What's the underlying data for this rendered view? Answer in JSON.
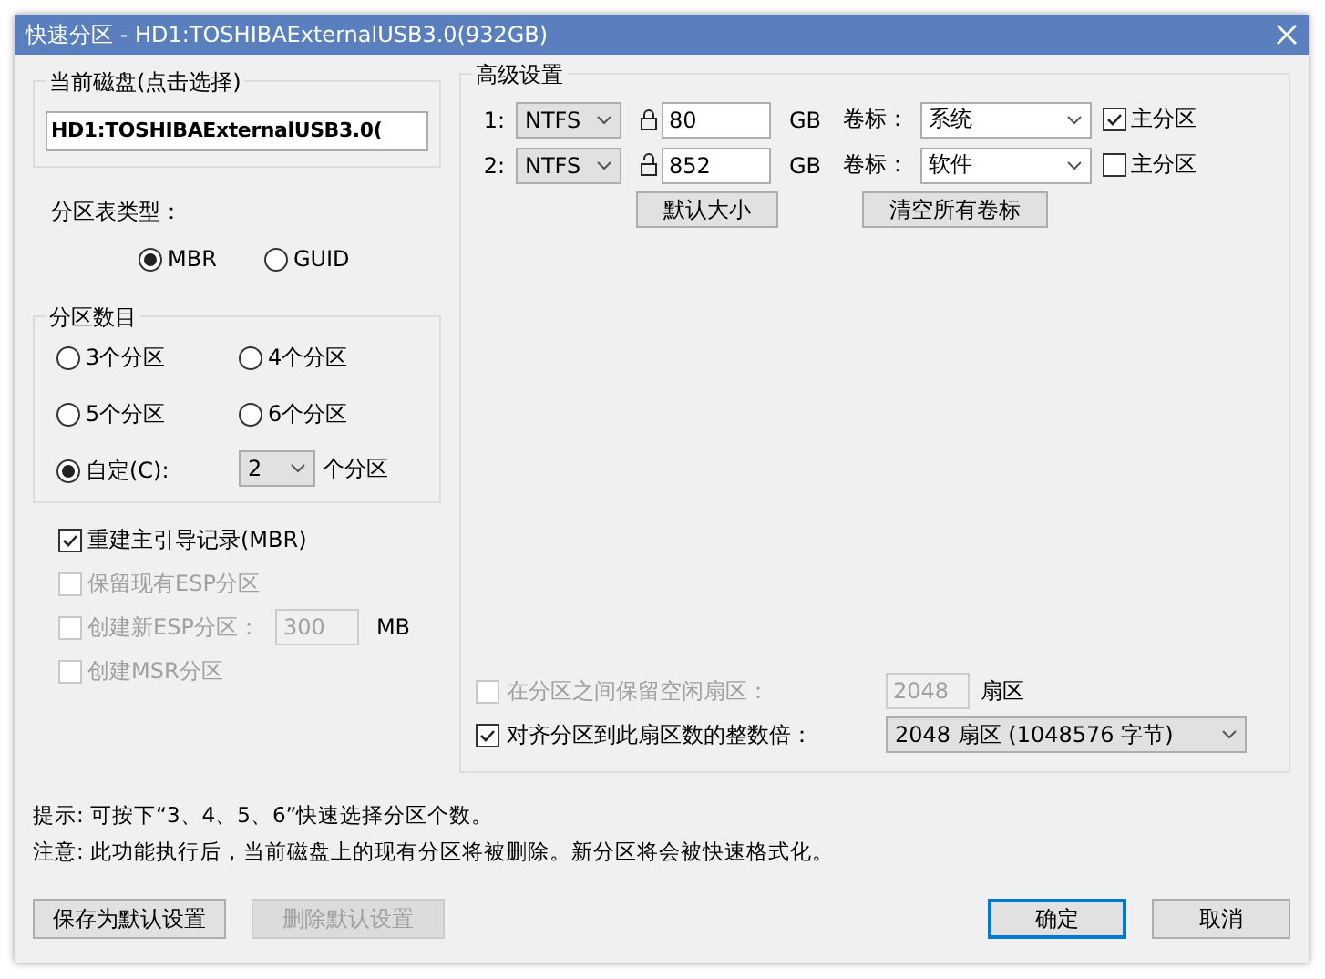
{
  "window": {
    "title": "快速分区 - HD1:TOSHIBAExternalUSB3.0(932GB)"
  },
  "disk_group": {
    "title": "当前磁盘(点击选择)",
    "value": "HD1:TOSHIBAExternalUSB3.0("
  },
  "partition_table": {
    "label": "分区表类型：",
    "options": [
      {
        "label": "MBR",
        "selected": true
      },
      {
        "label": "GUID",
        "selected": false
      }
    ]
  },
  "partition_count": {
    "title": "分区数目",
    "options": [
      {
        "label": "3个分区",
        "selected": false
      },
      {
        "label": "4个分区",
        "selected": false
      },
      {
        "label": "5个分区",
        "selected": false
      },
      {
        "label": "6个分区",
        "selected": false
      }
    ],
    "custom": {
      "label": "自定(C):",
      "selected": true,
      "value": "2",
      "suffix": "个分区"
    }
  },
  "options": [
    {
      "kind": "plain",
      "label": "重建主引导记录(MBR)",
      "checked": true,
      "disabled": false
    },
    {
      "kind": "plain",
      "label": "保留现有ESP分区",
      "checked": false,
      "disabled": true
    },
    {
      "kind": "size",
      "label": "创建新ESP分区：",
      "checked": false,
      "disabled": true,
      "value": "300",
      "unit": "MB"
    },
    {
      "kind": "plain",
      "label": "创建MSR分区",
      "checked": false,
      "disabled": true
    }
  ],
  "advanced": {
    "title": "高级设置",
    "partitions": [
      {
        "index": "1:",
        "fs": "NTFS",
        "locked": true,
        "size": "80",
        "unit": "GB",
        "label_caption": "卷标：",
        "volume_label": "系统",
        "primary_label": "主分区",
        "primary": true
      },
      {
        "index": "2:",
        "fs": "NTFS",
        "locked": false,
        "size": "852",
        "unit": "GB",
        "label_caption": "卷标：",
        "volume_label": "软件",
        "primary_label": "主分区",
        "primary": false
      }
    ],
    "buttons": [
      "默认大小",
      "清空所有卷标"
    ],
    "free_sectors": {
      "label": "在分区之间保留空闲扇区：",
      "checked": false,
      "disabled": true,
      "value": "2048",
      "unit": "扇区"
    },
    "align": {
      "label": "对齐分区到此扇区数的整数倍：",
      "checked": true,
      "value": "2048 扇区 (1048576 字节)"
    }
  },
  "hints": [
    "提示: 可按下“3、4、5、6”快速选择分区个数。",
    "注意: 此功能执行后，当前磁盘上的现有分区将被删除。新分区将会被快速格式化。"
  ],
  "buttons": [
    {
      "label": "保存为默认设置",
      "kind": "normal"
    },
    {
      "label": "删除默认设置",
      "kind": "disabled"
    },
    {
      "label": "确定",
      "kind": "primary"
    },
    {
      "label": "取消",
      "kind": "normal"
    }
  ]
}
